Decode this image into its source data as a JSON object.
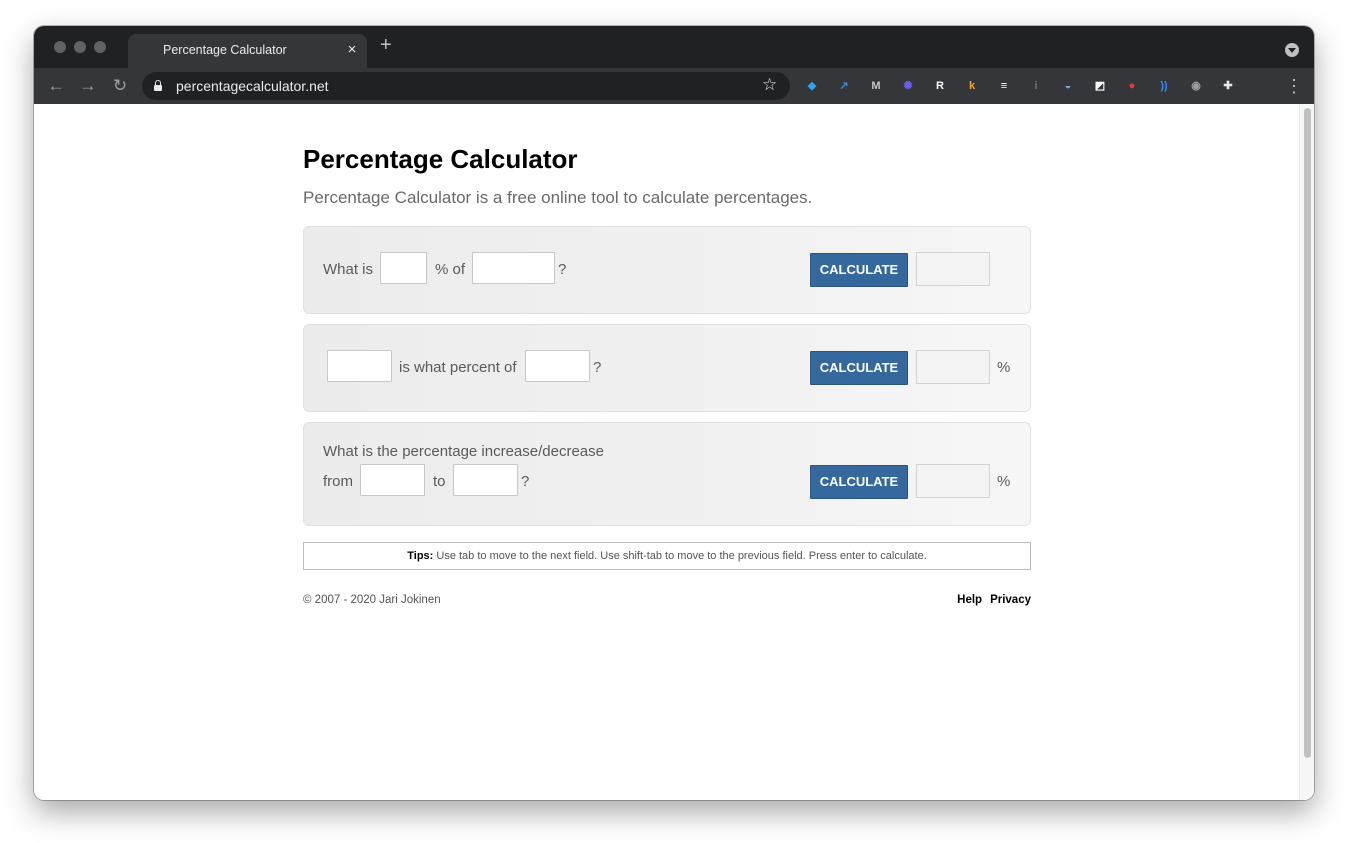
{
  "browser": {
    "tab_title": "Percentage Calculator",
    "tab_close": "×",
    "new_tab": "+",
    "url": "percentagecalculator.net",
    "bookmark_star": "☆",
    "nav": {
      "back": "←",
      "forward": "→",
      "reload": "↻"
    },
    "extensions": [
      {
        "name": "gem-extension-icon",
        "glyph": "◆",
        "color": "#2aa4f4"
      },
      {
        "name": "share-extension-icon",
        "glyph": "↗",
        "color": "#3a8ee6"
      },
      {
        "name": "m-extension-icon",
        "glyph": "M",
        "color": "#c7c7c7"
      },
      {
        "name": "sparkle-extension-icon",
        "glyph": "✺",
        "color": "#6b5cf0"
      },
      {
        "name": "r-extension-icon",
        "glyph": "R",
        "color": "#ffffff"
      },
      {
        "name": "k-extension-icon",
        "glyph": "k",
        "color": "#f2a33a"
      },
      {
        "name": "notes-extension-icon",
        "glyph": "≡",
        "color": "#ffffff"
      },
      {
        "name": "info-extension-icon",
        "glyph": "i",
        "color": "#6f7276"
      },
      {
        "name": "shield-extension-icon",
        "glyph": "◒",
        "color": "#7aa3f0"
      },
      {
        "name": "edit-extension-icon",
        "glyph": "◩",
        "color": "#ffffff"
      },
      {
        "name": "pokeball-extension-icon",
        "glyph": "●",
        "color": "#e23b3b"
      },
      {
        "name": "signal-extension-icon",
        "glyph": "))",
        "color": "#2f8cff"
      },
      {
        "name": "monkey-extension-icon",
        "glyph": "◉",
        "color": "#9aa0a6"
      },
      {
        "name": "puzzle-extensions-icon",
        "glyph": "✚",
        "color": "#e8eaed"
      }
    ],
    "menu": "⋮"
  },
  "page": {
    "title": "Percentage Calculator",
    "subtitle": "Percentage Calculator is a free online tool to calculate percentages."
  },
  "calc1": {
    "label_what_is": "What is",
    "label_percent_of": "% of",
    "label_question": "?",
    "button": "CALCULATE"
  },
  "calc2": {
    "label_is_what_percent_of": "is what percent of",
    "label_question": "?",
    "button": "CALCULATE",
    "suffix": "%"
  },
  "calc3": {
    "label_line1": "What is the percentage increase/decrease",
    "label_from": "from",
    "label_to": "to",
    "label_question": "?",
    "button": "CALCULATE",
    "suffix": "%"
  },
  "tips": {
    "label": "Tips:",
    "text": " Use tab to move to the next field. Use shift-tab to move to the previous field. Press enter to calculate."
  },
  "footer": {
    "copyright": "© 2007 - 2020 Jari Jokinen",
    "help": "Help",
    "privacy": "Privacy"
  }
}
